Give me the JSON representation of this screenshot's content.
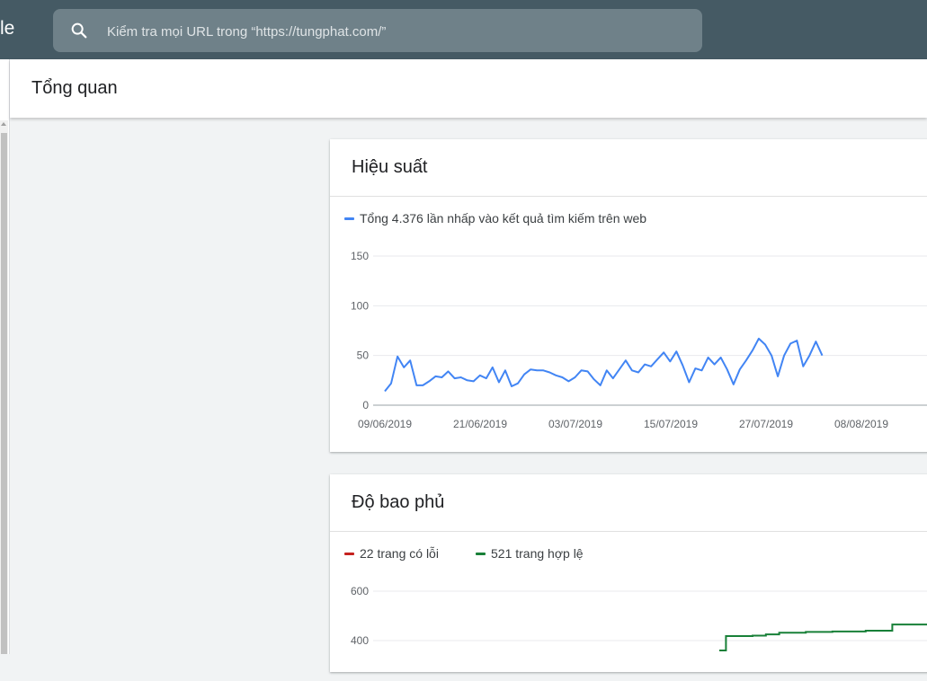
{
  "topbar": {
    "brand_fragment": "le",
    "search_placeholder": "Kiểm tra mọi URL trong “https://tungphat.com/”"
  },
  "page": {
    "title": "Tổng quan"
  },
  "performance": {
    "title": "Hiệu suất",
    "legend": "Tổng 4.376 lần nhấp vào kết quả tìm kiếm trên web",
    "color": "#4285f4"
  },
  "coverage": {
    "title": "Độ bao phủ",
    "legend_error": "22 trang có lỗi",
    "legend_valid": "521 trang hợp lệ",
    "color_error": "#c5221f",
    "color_valid": "#188038"
  },
  "chart_data": [
    {
      "type": "line",
      "ylim": [
        0,
        150
      ],
      "yticks": [
        0,
        50,
        100,
        150
      ],
      "xtick_labels": [
        "09/06/2019",
        "21/06/2019",
        "03/07/2019",
        "15/07/2019",
        "27/07/2019",
        "08/08/2019"
      ],
      "series": [
        {
          "name": "Tổng 4.376 lần nhấp vào kết quả tìm kiếm trên web",
          "values": [
            14,
            22,
            49,
            38,
            45,
            20,
            20,
            24,
            29,
            28,
            34,
            27,
            28,
            25,
            24,
            30,
            27,
            38,
            23,
            35,
            19,
            22,
            31,
            36,
            35,
            35,
            33,
            30,
            28,
            24,
            28,
            35,
            34,
            26,
            20,
            35,
            27,
            36,
            45,
            35,
            33,
            41,
            39,
            46,
            53,
            44,
            54,
            40,
            23,
            37,
            35,
            48,
            41,
            48,
            36,
            21,
            36,
            45,
            55,
            67,
            61,
            50,
            29,
            50,
            62,
            65,
            39,
            50,
            64,
            50
          ]
        }
      ]
    },
    {
      "type": "line",
      "ylim": [
        0,
        600
      ],
      "yticks": [
        400,
        600
      ],
      "series": [
        {
          "name": "22 trang có lỗi",
          "values": []
        },
        {
          "name": "521 trang hợp lệ",
          "values": [
            360,
            418,
            418,
            418,
            418,
            420,
            420,
            425,
            425,
            432,
            432,
            432,
            432,
            435,
            435,
            435,
            435,
            437,
            437,
            437,
            437,
            437,
            440,
            440,
            440,
            440,
            465,
            465,
            465,
            465
          ]
        }
      ]
    }
  ]
}
